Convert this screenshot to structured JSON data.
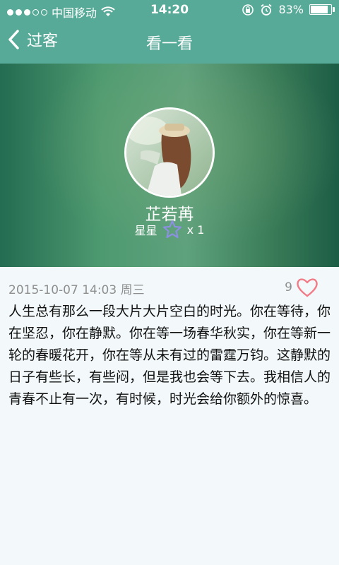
{
  "status_bar": {
    "carrier": "中国移动",
    "time": "14:20",
    "battery": "83%",
    "battery_level": 0.83
  },
  "nav": {
    "back_label": "过客",
    "title": "看一看"
  },
  "profile": {
    "name": "芷若苒",
    "rank_label": "星星",
    "rank_count": "x 1"
  },
  "post": {
    "datetime": "2015-10-07 14:03",
    "weekday": "周三",
    "like_count": "9",
    "text": "人生总有那么一段大片大片空白的时光。你在等待，你在坚忍，你在静默。你在等一场春华秋实，你在等新一轮的春暖花开，你在等从未有过的雷霆万钧。这静默的日子有些长，有些闷，但是我也会等下去。我相信人的青春不止有一次，有时候，时光会给你额外的惊喜。"
  },
  "colors": {
    "nav_bg": "#58aa98",
    "like_heart": "#f17b86",
    "star_outline": "#8d8fe0"
  }
}
